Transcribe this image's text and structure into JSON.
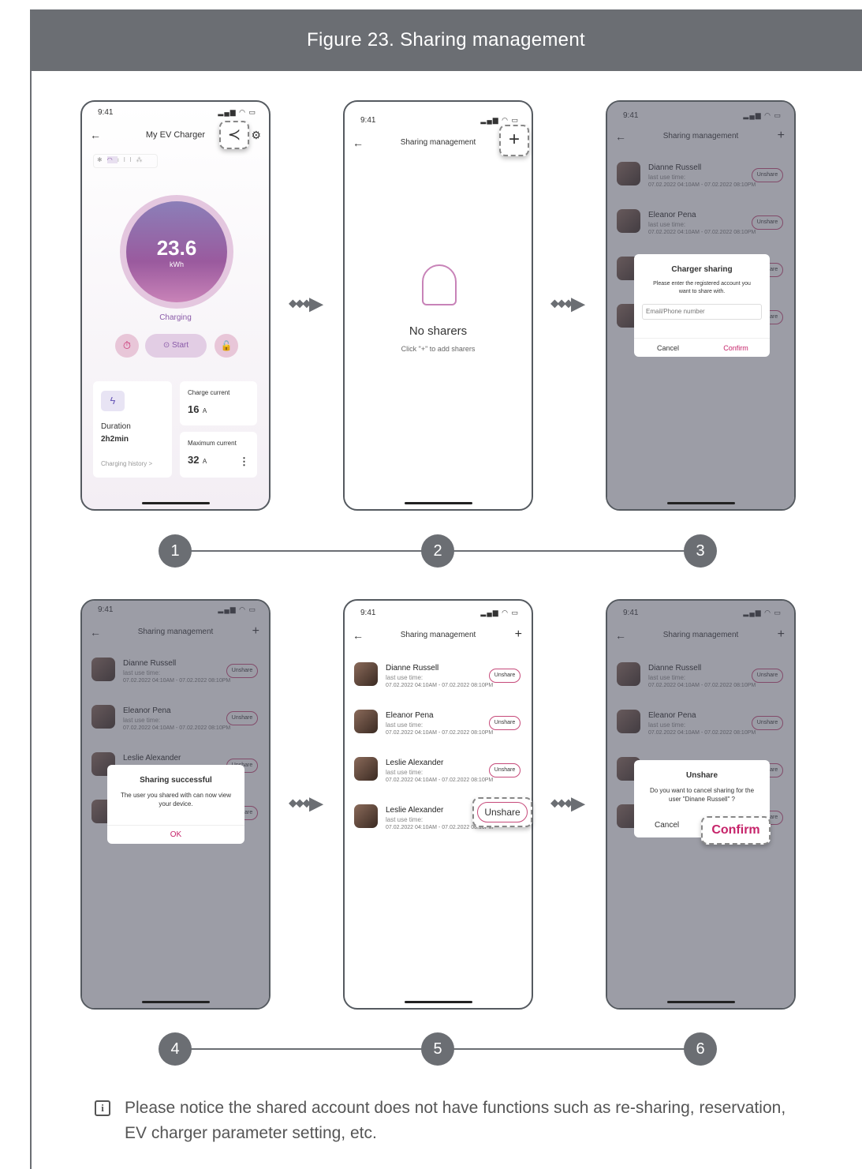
{
  "figure_title": "Figure 23.  Sharing management",
  "status_time": "9:41",
  "s1": {
    "title": "My EV Charger",
    "value": "23.6",
    "unit": "kWh",
    "state": "Charging",
    "start": "Start",
    "duration_label": "Duration",
    "duration_value": "2h2min",
    "history": "Charging history  >",
    "cc_label": "Charge current",
    "cc_value": "16",
    "cc_unit": "A",
    "mc_label": "Maximum current",
    "mc_value": "32",
    "mc_unit": "A"
  },
  "sharing_title": "Sharing management",
  "s2": {
    "empty_title": "No sharers",
    "empty_sub": "Click \"+\" to add sharers"
  },
  "rows": [
    {
      "name": "Dianne Russell",
      "label": "last use time:",
      "date": "07.02.2022 04:10AM - 07.02.2022 08:10PM"
    },
    {
      "name": "Eleanor Pena",
      "label": "last use time:",
      "date": "07.02.2022 04:10AM - 07.02.2022 08:10PM"
    },
    {
      "name": "Leslie Alexander",
      "label": "last use time:",
      "date": "07.02.2022 04:10AM - 07.02.2022 08:10PM"
    },
    {
      "name": "Leslie Alexander",
      "label": "last use time:",
      "date": "07.02.2022 04:10AM - 07.02.2022 08:10PM"
    }
  ],
  "unshare": "Unshare",
  "s3": {
    "title": "Charger sharing",
    "msg": "Please enter the registered account you want to share with.",
    "placeholder": "Email/Phone number",
    "cancel": "Cancel",
    "confirm": "Confirm"
  },
  "s4": {
    "title": "Sharing successful",
    "msg": "The user you shared with can now view your device.",
    "ok": "OK"
  },
  "s6": {
    "title": "Unshare",
    "msg": "Do you want to cancel sharing for the user \"Dinane Russell\" ?",
    "cancel": "Cancel",
    "confirm": "Confirm"
  },
  "steps": [
    "1",
    "2",
    "3",
    "4",
    "5",
    "6"
  ],
  "note": "Please notice the shared account does not have functions such as re-sharing, reservation, EV charger parameter setting, etc.",
  "colors": {
    "frame": "#6b6e73",
    "accent": "#c6246a",
    "purple": "#8a5aa8"
  }
}
